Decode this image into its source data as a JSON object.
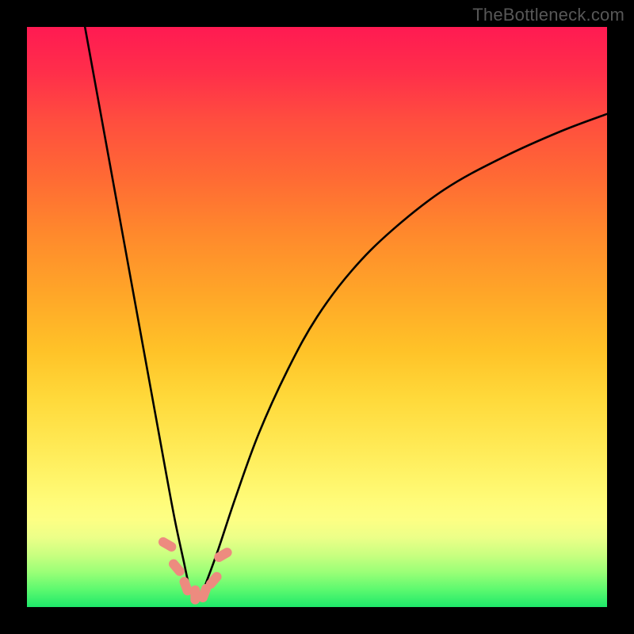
{
  "watermark": "TheBottleneck.com",
  "colors": {
    "frame": "#000000",
    "curve_stroke": "#000000",
    "marker_fill": "#ed8b7f",
    "gradient_stops": [
      "#ff1a52",
      "#ff2f4a",
      "#ff4d3f",
      "#ff6a34",
      "#ff8a2c",
      "#ffa628",
      "#ffc328",
      "#ffd93a",
      "#ffe954",
      "#fff56a",
      "#fffc7a",
      "#fdff84",
      "#ecff88",
      "#c9ff80",
      "#9aff77",
      "#5cf96f",
      "#1ee86a"
    ]
  },
  "chart_data": {
    "type": "line",
    "title": "",
    "xlabel": "",
    "ylabel": "",
    "xlim": [
      0,
      100
    ],
    "ylim": [
      0,
      100
    ],
    "grid": false,
    "note": "Axes are unlabeled in the source image; values are normalized 0–100 estimates of curve shape. Curve appears to be a V-shaped bottleneck profile with minimum near x≈29.",
    "series": [
      {
        "name": "left-branch",
        "x": [
          10.0,
          12.0,
          14.0,
          16.0,
          18.0,
          20.0,
          22.0,
          24.0,
          25.5,
          27.0,
          28.0,
          29.0
        ],
        "y": [
          100.0,
          89.0,
          78.0,
          67.0,
          56.0,
          45.0,
          34.0,
          23.0,
          15.0,
          8.0,
          3.5,
          1.0
        ]
      },
      {
        "name": "right-branch",
        "x": [
          29.0,
          30.0,
          31.0,
          33.0,
          36.0,
          40.0,
          45.0,
          50.0,
          56.0,
          63.0,
          72.0,
          82.0,
          92.0,
          100.0
        ],
        "y": [
          1.0,
          2.0,
          4.5,
          10.0,
          19.0,
          30.0,
          41.0,
          50.0,
          58.0,
          65.0,
          72.0,
          77.5,
          82.0,
          85.0
        ]
      }
    ],
    "markers": [
      {
        "x": 24.2,
        "y": 10.8
      },
      {
        "x": 25.8,
        "y": 6.8
      },
      {
        "x": 27.4,
        "y": 3.6
      },
      {
        "x": 29.0,
        "y": 2.1
      },
      {
        "x": 30.6,
        "y": 2.4
      },
      {
        "x": 32.2,
        "y": 4.6
      },
      {
        "x": 33.8,
        "y": 9.0
      }
    ]
  }
}
